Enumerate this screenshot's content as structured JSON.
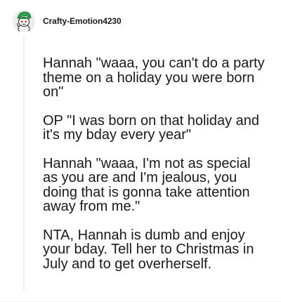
{
  "comment": {
    "username": "Crafty-Emotion4230",
    "avatar": {
      "icon": "snoo-avatar-icon",
      "hat_color": "#2e9e4f",
      "skin_color": "#f4f4f4"
    },
    "paragraphs": [
      "Hannah \"waaa, you can't do a party theme on a holiday you were born on\"",
      "OP \"I was born on that holiday and it's my bday every year\"",
      "Hannah \"waaa, I'm not as special as you are and I'm jealous, you doing that is gonna take attention away from me.\"",
      "NTA, Hannah is dumb and enjoy your bday. Tell her to Christmas in July and to get overherself."
    ]
  }
}
